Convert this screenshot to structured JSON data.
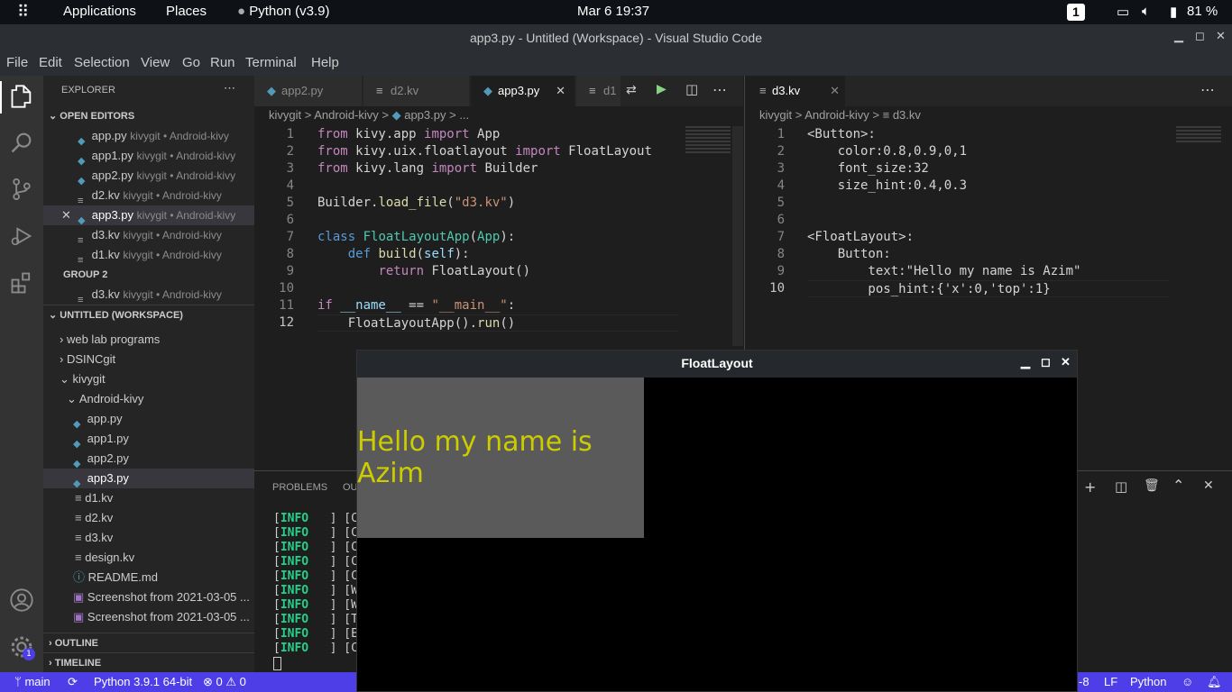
{
  "topbar": {
    "applications": "Applications",
    "places": "Places",
    "python_app": "Python (v3.9)",
    "clock": "Mar 6  19:37",
    "workspace": "1",
    "battery": "81 %"
  },
  "window": {
    "title": "app3.py - Untitled (Workspace) - Visual Studio Code"
  },
  "menu": [
    "File",
    "Edit",
    "Selection",
    "View",
    "Go",
    "Run",
    "Terminal",
    "Help"
  ],
  "explorer": {
    "title": "EXPLORER",
    "open_editors_label": "OPEN EDITORS",
    "open_editors": [
      {
        "name": "app.py",
        "meta": "kivygit • Android-kivy",
        "icon": "python"
      },
      {
        "name": "app1.py",
        "meta": "kivygit • Android-kivy",
        "icon": "python"
      },
      {
        "name": "app2.py",
        "meta": "kivygit • Android-kivy",
        "icon": "python"
      },
      {
        "name": "d2.kv",
        "meta": "kivygit • Android-kivy",
        "icon": "lines"
      },
      {
        "name": "app3.py",
        "meta": "kivygit • Android-kivy",
        "icon": "python"
      },
      {
        "name": "d3.kv",
        "meta": "kivygit • Android-kivy",
        "icon": "lines"
      },
      {
        "name": "d1.kv",
        "meta": "kivygit • Android-kivy",
        "icon": "lines"
      }
    ],
    "group2_label": "GROUP 2",
    "group2_item": {
      "name": "d3.kv",
      "meta": "kivygit • Android-kivy"
    },
    "workspace_label": "UNTITLED (WORKSPACE)",
    "tree": [
      {
        "name": "web lab programs"
      },
      {
        "name": "DSINCgit"
      },
      {
        "name": "kivygit"
      },
      {
        "name": "Android-kivy"
      },
      {
        "name": "app.py"
      },
      {
        "name": "app1.py"
      },
      {
        "name": "app2.py"
      },
      {
        "name": "app3.py"
      },
      {
        "name": "d1.kv"
      },
      {
        "name": "d2.kv"
      },
      {
        "name": "d3.kv"
      },
      {
        "name": "design.kv"
      },
      {
        "name": "README.md"
      },
      {
        "name": "Screenshot from 2021-03-05 ..."
      },
      {
        "name": "Screenshot from 2021-03-05 ..."
      }
    ],
    "outline_label": "OUTLINE",
    "timeline_label": "TIMELINE"
  },
  "editor1": {
    "tabs": [
      "app2.py",
      "d2.kv",
      "app3.py",
      "d1"
    ],
    "breadcrumb": [
      "kivygit",
      "Android-kivy",
      "app3.py",
      "..."
    ],
    "line_numbers": [
      "1",
      "2",
      "3",
      "4",
      "5",
      "6",
      "7",
      "8",
      "9",
      "10",
      "11",
      "12"
    ],
    "code": {
      "l1a": "from",
      "l1b": " kivy.app ",
      "l1c": "import",
      "l1d": " App",
      "l2a": "from",
      "l2b": " kivy.uix.floatlayout ",
      "l2c": "import",
      "l2d": " FloatLayout",
      "l3a": "from",
      "l3b": " kivy.lang ",
      "l3c": "import",
      "l3d": " Builder",
      "l5a": "Builder.",
      "l5b": "load_file",
      "l5c": "(",
      "l5d": "\"d3.kv\"",
      "l5e": ")",
      "l7a": "class",
      "l7b": " FloatLayoutApp",
      "l7c": "(",
      "l7d": "App",
      "l7e": "):",
      "l8a": "    ",
      "l8b": "def",
      "l8c": " build",
      "l8d": "(",
      "l8e": "self",
      "l8f": "):",
      "l9a": "        ",
      "l9b": "return",
      "l9c": " FloatLayout()",
      "l11a": "if",
      "l11b": " __name__",
      "l11c": " == ",
      "l11d": "\"__main__\"",
      "l11e": ":",
      "l12a": "    FloatLayoutApp().",
      "l12b": "run",
      "l12c": "()"
    }
  },
  "editor2": {
    "tab": "d3.kv",
    "breadcrumb": [
      "kivygit",
      "Android-kivy",
      "d3.kv"
    ],
    "line_numbers": [
      "1",
      "2",
      "3",
      "4",
      "5",
      "6",
      "7",
      "8",
      "9",
      "10"
    ],
    "lines": [
      "<Button>:",
      "    color:0.8,0.9,0,1",
      "    font_size:32",
      "    size_hint:0.4,0.3",
      "",
      "",
      "<FloatLayout>:",
      "    Button:",
      "        text:\"Hello my name is Azim\"",
      "        pos_hint:{'x':0,'top':1}"
    ]
  },
  "panel": {
    "tab_problems": "PROBLEMS",
    "tab_output_partial": "OU",
    "log_level": "INFO",
    "log_prefixes": [
      "[C",
      "[C",
      "[C",
      "[C",
      "[C",
      "[W",
      "[W",
      "[T",
      "[E",
      "[C"
    ]
  },
  "kivy_window": {
    "title": "FloatLayout",
    "button_text": "Hello my name is Azim"
  },
  "statusbar": {
    "branch": "main",
    "python": "Python 3.9.1 64-bit",
    "problems": "0",
    "warnings": "0",
    "encoding_partial": "-8",
    "eol": "LF",
    "language": "Python"
  },
  "colors": {
    "statusbar": "#4d3ee8",
    "kivy_text": "#cccc00",
    "kivy_button": "#5a5a5a"
  }
}
